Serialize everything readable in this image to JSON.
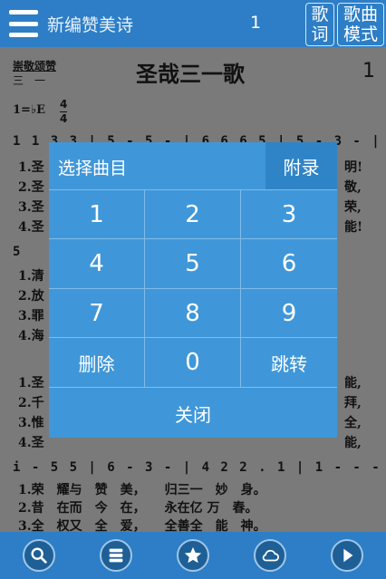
{
  "header": {
    "title": "新编赞美诗",
    "page": "1",
    "lyrics_btn": "歌\n词",
    "lyrics_btn_top": "歌",
    "lyrics_btn_bottom": "词",
    "mode_btn_top": "歌曲",
    "mode_btn_bottom": "模式"
  },
  "sheet": {
    "collection": "崇敬颂赞",
    "collection_sub": "三　一",
    "song_title": "圣哉三一歌",
    "song_number": "1",
    "key": "1=♭E",
    "time_top": "4",
    "time_bottom": "4",
    "lines": [
      "1 1 3 3 | 5 - 5 - | 6 6 6 5 | 5 - 3 - |",
      "5",
      "i - 5 5 | 6 - 3 - | 4 2 2 . 1 | 1 - - - |"
    ],
    "lyric_rows_top": [
      "1.圣",
      "2.圣",
      "3.圣",
      "4.圣"
    ],
    "lyric_rows_top_end": [
      "明!",
      "敬,",
      "荣,",
      "能!"
    ],
    "lyric_rows_mid": [
      "1.清",
      "2.放",
      "3.罪",
      "4.海"
    ],
    "lyric_rows_low": [
      "1.圣",
      "2.千",
      "3.惟",
      "4.圣"
    ],
    "lyric_rows_low_end": [
      "能,",
      "拜,",
      "全,",
      "能,"
    ],
    "lyric_rows_bottom": [
      "1.荣　耀与　赞　美，　　归三一　妙　身。",
      "2.昔　在而　今　在，　　永在亿 万　春。",
      "3.全　权又　全　爱，　　全善全　能　神。"
    ]
  },
  "dialog": {
    "title": "选择曲目",
    "appendix": "附录",
    "keys": [
      "1",
      "2",
      "3",
      "4",
      "5",
      "6",
      "7",
      "8",
      "9",
      "删除",
      "0",
      "跳转"
    ],
    "close": "关闭"
  },
  "toolbar": {
    "items": [
      "search-icon",
      "catalog-icon",
      "star-icon",
      "cloud-icon",
      "play-icon"
    ]
  },
  "colors": {
    "primary": "#2d7ec6",
    "dialog": "#3f97d9",
    "appendix": "#2f84c7"
  }
}
